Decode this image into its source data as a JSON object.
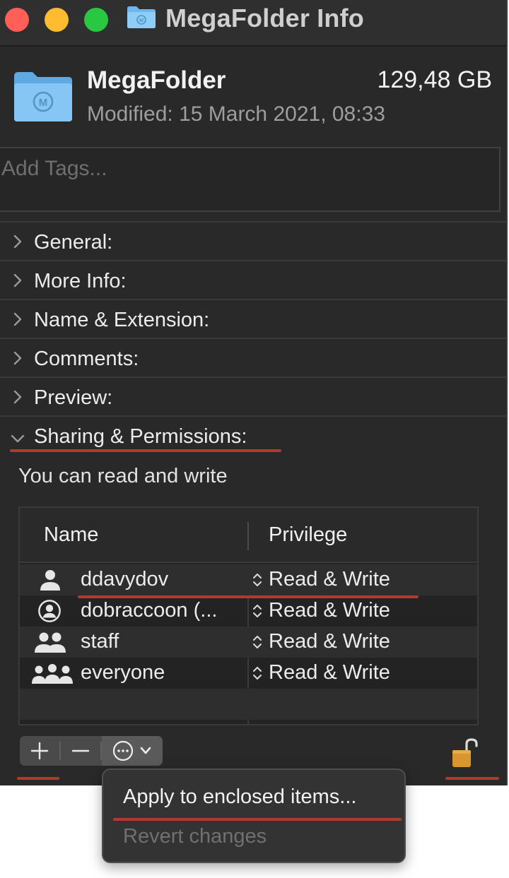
{
  "window": {
    "title": "MegaFolder Info"
  },
  "header": {
    "name": "MegaFolder",
    "size": "129,48 GB",
    "modified": "Modified: 15 March 2021, 08:33"
  },
  "tags": {
    "placeholder": "Add Tags..."
  },
  "sections": {
    "general": "General:",
    "more_info": "More Info:",
    "name_extension": "Name & Extension:",
    "comments": "Comments:",
    "preview": "Preview:",
    "sharing": "Sharing & Permissions:"
  },
  "permissions": {
    "summary": "You can read and write",
    "columns": {
      "name": "Name",
      "privilege": "Privilege"
    },
    "rows": [
      {
        "name": "ddavydov",
        "privilege": "Read & Write",
        "icon": "user-icon"
      },
      {
        "name": "dobraccoon (...",
        "privilege": "Read & Write",
        "icon": "user-circle-icon"
      },
      {
        "name": "staff",
        "privilege": "Read & Write",
        "icon": "group-icon"
      },
      {
        "name": "everyone",
        "privilege": "Read & Write",
        "icon": "everyone-icon"
      }
    ]
  },
  "toolbar": {
    "add": "+",
    "remove": "−"
  },
  "menu": {
    "apply": "Apply to enclosed items...",
    "revert": "Revert changes"
  },
  "colors": {
    "window_bg": "#292929",
    "folder_blue": "#7cc2f5",
    "annotation_red": "#b23a2c",
    "lock_gold": "#d9962f"
  }
}
